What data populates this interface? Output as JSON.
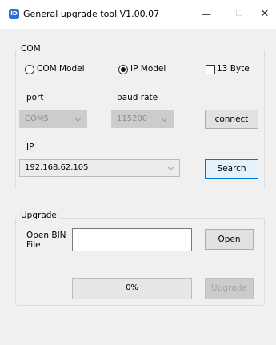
{
  "window": {
    "title": "General upgrade tool V1.00.07",
    "icon_text": "ID",
    "minimize": "—",
    "maximize": "☐",
    "close": "✕"
  },
  "com_group": {
    "label": "COM",
    "mode_com_label": "COM Model",
    "mode_ip_label": "IP Model",
    "selected_mode": "IP Model",
    "byte13_label": "13 Byte",
    "byte13_checked": false,
    "port_label": "port",
    "port_value": "COM5",
    "baud_label": "baud rate",
    "baud_value": "115200",
    "connect_label": "connect",
    "ip_label": "IP",
    "ip_value": "192.168.62.105",
    "search_label": "Search"
  },
  "upgrade_group": {
    "label": "Upgrade",
    "open_bin_label": "Open BIN\nFile",
    "file_path": "",
    "open_label": "Open",
    "progress_text": "0%",
    "progress_fraction": 0.0,
    "upgrade_label": "Upgrade"
  }
}
